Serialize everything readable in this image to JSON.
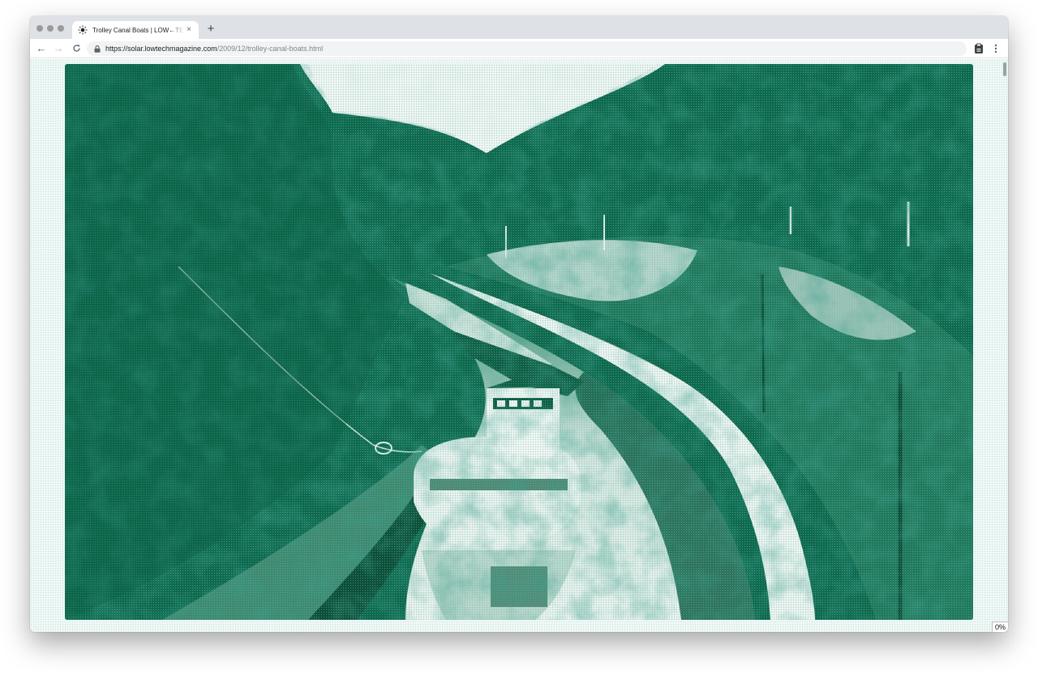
{
  "browser": {
    "tab": {
      "title": "Trolley Canal Boats | LOW←TECH MAGAZINE",
      "favicon": "sun-icon",
      "close": "×"
    },
    "new_tab": "+",
    "nav": {
      "back": "←",
      "forward": "→",
      "reload": "C"
    },
    "url": {
      "host": "https://solar.lowtechmagazine.com",
      "path": "/2009/12/trolley-canal-boats.html"
    }
  },
  "page": {
    "hero_image": "dithered photograph of canal boats in a wooded cutting",
    "caption_peek": "",
    "load_progress": "0%",
    "accent": "#006b4e",
    "background": "#eef8f6"
  }
}
